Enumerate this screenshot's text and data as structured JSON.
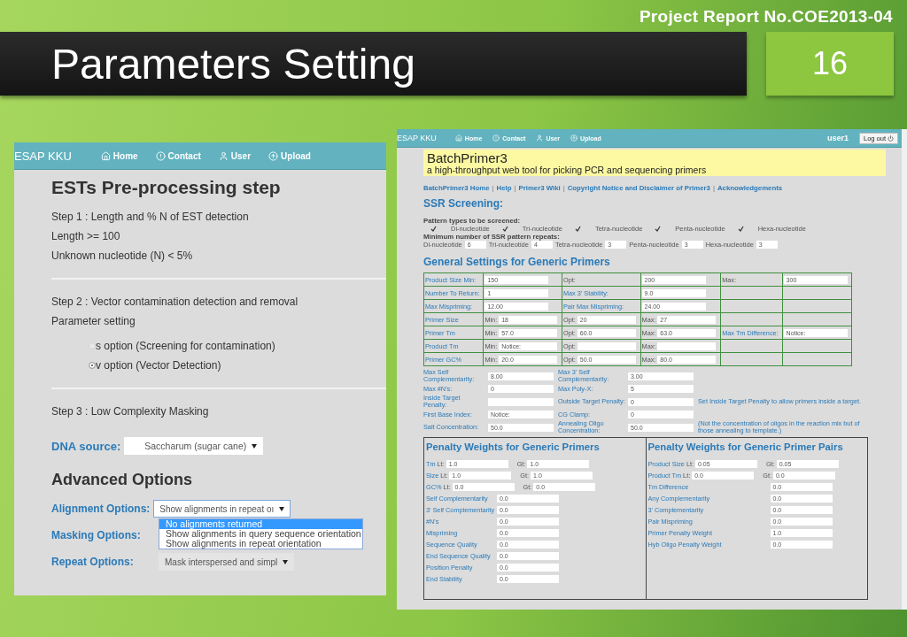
{
  "header": {
    "report": "Project Report No.COE2013-04",
    "title": "Parameters Setting",
    "page": "16"
  },
  "left": {
    "nav": {
      "brand": "ESAP KKU",
      "items": [
        "Home",
        "Contact",
        "User",
        "Upload"
      ]
    },
    "heading": "ESTs Pre-processing step",
    "step1": [
      "Step 1 : Length and % N of EST detection",
      "Length >= 100",
      "Unknown nucleotide (N) < 5%"
    ],
    "step2": [
      "Step 2 : Vector contamination detection and removal",
      "Parameter setting"
    ],
    "radios": [
      {
        "label": "s option (Screening for contamination)",
        "selected": false
      },
      {
        "label": "v option (Vector Detection)",
        "selected": true
      }
    ],
    "step3": "Step 3 : Low Complexity Masking",
    "dna_source": {
      "label": "DNA source:",
      "value": "Saccharum (sugar cane)"
    },
    "advanced_heading": "Advanced Options",
    "options": [
      {
        "label": "Alignment Options:",
        "value": "Show alignments in repeat oı",
        "focused": true
      },
      {
        "label": "Masking Options:"
      },
      {
        "label": "Repeat Options:",
        "value": "Mask interspersed and simpl",
        "focused": false
      }
    ],
    "menu": [
      {
        "label": "No alignments returned",
        "selected": true
      },
      {
        "label": "Show alignments in query sequence orientation",
        "selected": false
      },
      {
        "label": "Show alignments in repeat orientation",
        "selected": false
      }
    ]
  },
  "right": {
    "nav": {
      "brand": "ESAP KKU",
      "items": [
        "Home",
        "Contact",
        "User",
        "Upload"
      ],
      "user": "user1",
      "logout": "Log out"
    },
    "banner": {
      "title": "BatchPrimer3",
      "subtitle": "a high-throughput web tool for picking PCR and sequencing primers"
    },
    "links": [
      "BatchPrimer3 Home",
      "Help",
      "Primer3 Wiki",
      "Copyright Notice and Disclaimer of Primer3",
      "Acknowledgements"
    ],
    "separator": "|",
    "ssr_heading": "SSR Screening:",
    "pattern_label": "Pattern types to be screened:",
    "patterns": [
      {
        "label": "Di-nucleotide",
        "checked": true
      },
      {
        "label": "Tri-nucleotide",
        "checked": true
      },
      {
        "label": "Tetra-nucleotide",
        "checked": true
      },
      {
        "label": "Penta-nucleotide",
        "checked": true
      },
      {
        "label": "Hexa-nucleotide",
        "checked": true
      }
    ],
    "repeats_label": "Minimum number of SSR pattern repeats:",
    "repeats": [
      {
        "label": "Di-nucleotide",
        "value": "6"
      },
      {
        "label": "Tri-nucleotide",
        "value": "4"
      },
      {
        "label": "Tetra-nucleotide",
        "value": "3"
      },
      {
        "label": "Penta-nucleotide",
        "value": "3"
      },
      {
        "label": "Hexa-nucleotide",
        "value": "3"
      }
    ],
    "general_heading": "General Settings for Generic Primers",
    "table": [
      [
        {
          "kind": "label",
          "text": "Product Size Min:"
        },
        {
          "kind": "input",
          "value": "150"
        },
        {
          "kind": "plain",
          "text": "Opt:"
        },
        {
          "kind": "input",
          "value": "200"
        },
        {
          "kind": "plain",
          "text": "Max:"
        },
        {
          "kind": "input",
          "value": "300"
        }
      ],
      [
        {
          "kind": "label",
          "text": "Number To Return:"
        },
        {
          "kind": "input",
          "value": "1"
        },
        {
          "kind": "label",
          "text": "Max 3' Stability:"
        },
        {
          "kind": "input",
          "value": "9.0"
        },
        {
          "kind": "empty"
        },
        {
          "kind": "empty"
        }
      ],
      [
        {
          "kind": "label",
          "text": "Max Mispriming:"
        },
        {
          "kind": "input",
          "value": "12.00"
        },
        {
          "kind": "label",
          "text": "Pair Max Mispriming:"
        },
        {
          "kind": "input",
          "value": "24.00"
        },
        {
          "kind": "empty"
        },
        {
          "kind": "empty"
        }
      ],
      [
        {
          "kind": "label",
          "text": "Primer Size"
        },
        {
          "kind": "input",
          "prefix": "Min:",
          "value": "18"
        },
        {
          "kind": "input",
          "prefix": "Opt:",
          "value": "20"
        },
        {
          "kind": "input",
          "prefix": "Max:",
          "value": "27"
        },
        {
          "kind": "empty"
        },
        {
          "kind": "empty"
        }
      ],
      [
        {
          "kind": "label",
          "text": "Primer Tm"
        },
        {
          "kind": "input",
          "prefix": "Min:",
          "value": "57.0"
        },
        {
          "kind": "input",
          "prefix": "Opt:",
          "value": "60.0"
        },
        {
          "kind": "input",
          "prefix": "Max:",
          "value": "63.0"
        },
        {
          "kind": "label",
          "text": "Max Tm Difference:"
        },
        {
          "kind": "input",
          "value": "Notice:"
        }
      ],
      [
        {
          "kind": "label",
          "text": "Product Tm"
        },
        {
          "kind": "input",
          "prefix": "Min:",
          "value": "Notice:"
        },
        {
          "kind": "input",
          "prefix": "Opt:"
        },
        {
          "kind": "input",
          "prefix": "Max:"
        },
        {
          "kind": "empty"
        },
        {
          "kind": "empty"
        }
      ],
      [
        {
          "kind": "label",
          "text": "Primer GC%"
        },
        {
          "kind": "input",
          "prefix": "Min:",
          "value": "20.0"
        },
        {
          "kind": "input",
          "prefix": "Opt:",
          "value": "50.0"
        },
        {
          "kind": "input",
          "prefix": "Max:",
          "value": "80.0"
        },
        {
          "kind": "empty"
        },
        {
          "kind": "empty"
        }
      ]
    ],
    "extras": [
      {
        "fields": [
          {
            "label": "Max Self Complementarity:",
            "value": "8.00"
          },
          {
            "label": "Max 3' Self Complementarity:",
            "value": "3.00"
          }
        ]
      },
      {
        "fields": [
          {
            "label": "Max #N's:",
            "value": "0"
          },
          {
            "label": "Max Poly-X:",
            "value": "5"
          }
        ]
      },
      {
        "fields": [
          {
            "label": "Inside Target Penalty:"
          },
          {
            "label": "Outside Target Penalty:",
            "value": "0"
          }
        ],
        "note": "Set Inside Target Penalty to allow primers inside a target."
      },
      {
        "fields": [
          {
            "label": "First Base Index:",
            "value": "Notice:"
          },
          {
            "label": "CG Clamp:",
            "value": "0"
          }
        ]
      },
      {
        "fields": [
          {
            "label": "Salt Concentration:",
            "value": "50.0"
          },
          {
            "label": "Annealing Oligo Concentration:",
            "value": "50.0"
          }
        ],
        "note": "(Not the concentration of oligos in the reaction mix but of those annealing to template.)"
      }
    ],
    "penalties": [
      {
        "heading": "Penalty Weights for Generic Primers",
        "rows": [
          {
            "label": "Tm",
            "fields": [
              {
                "prefix": "Lt:",
                "value": "1.0"
              },
              {
                "prefix": "Gt:",
                "value": "1.0"
              }
            ]
          },
          {
            "label": "Size",
            "fields": [
              {
                "prefix": "Lt:",
                "value": "1.0"
              },
              {
                "prefix": "Gt:",
                "value": "1.0"
              }
            ]
          },
          {
            "label": "GC%",
            "fields": [
              {
                "prefix": "Lt:",
                "value": "0.0"
              },
              {
                "prefix": "Gt:",
                "value": "0.0"
              }
            ]
          },
          {
            "label": "Self Complementarity",
            "fields": [
              {
                "value": "0.0"
              }
            ]
          },
          {
            "label": "3' Self Complementarity",
            "fields": [
              {
                "value": "0.0"
              }
            ]
          },
          {
            "label": "#N's",
            "fields": [
              {
                "value": "0.0"
              }
            ]
          },
          {
            "label": "Mispriming",
            "fields": [
              {
                "value": "0.0"
              }
            ]
          },
          {
            "label": "Sequence Quality",
            "fields": [
              {
                "value": "0.0"
              }
            ]
          },
          {
            "label": "End Sequence Quality",
            "fields": [
              {
                "value": "0.0"
              }
            ]
          },
          {
            "label": "Position Penalty",
            "fields": [
              {
                "value": "0.0"
              }
            ]
          },
          {
            "label": "End Stability",
            "fields": [
              {
                "value": "0.0"
              }
            ]
          }
        ]
      },
      {
        "heading": "Penalty Weights for Generic Primer Pairs",
        "rows": [
          {
            "label": "Product Size",
            "fields": [
              {
                "prefix": "Lt:",
                "value": "0.05"
              },
              {
                "prefix": "Gt:",
                "value": "0.05"
              }
            ]
          },
          {
            "label": "Product Tm",
            "fields": [
              {
                "prefix": "Lt:",
                "value": "0.0"
              },
              {
                "prefix": "Gt:",
                "value": "0.0"
              }
            ]
          },
          {
            "label": "Tm Difference",
            "fields": [
              {
                "value": "0.0"
              }
            ]
          },
          {
            "label": "Any Complementarity",
            "fields": [
              {
                "value": "0.0"
              }
            ]
          },
          {
            "label": "3' Complementarity",
            "fields": [
              {
                "value": "0.0"
              }
            ]
          },
          {
            "label": "Pair Mispriming",
            "fields": [
              {
                "value": "0.0"
              }
            ]
          },
          {
            "label": "Primer Penalty Weight",
            "fields": [
              {
                "value": "1.0"
              }
            ]
          },
          {
            "label": "Hyb Oligo Penalty Weight",
            "fields": [
              {
                "value": "0.0"
              }
            ]
          }
        ]
      }
    ]
  }
}
